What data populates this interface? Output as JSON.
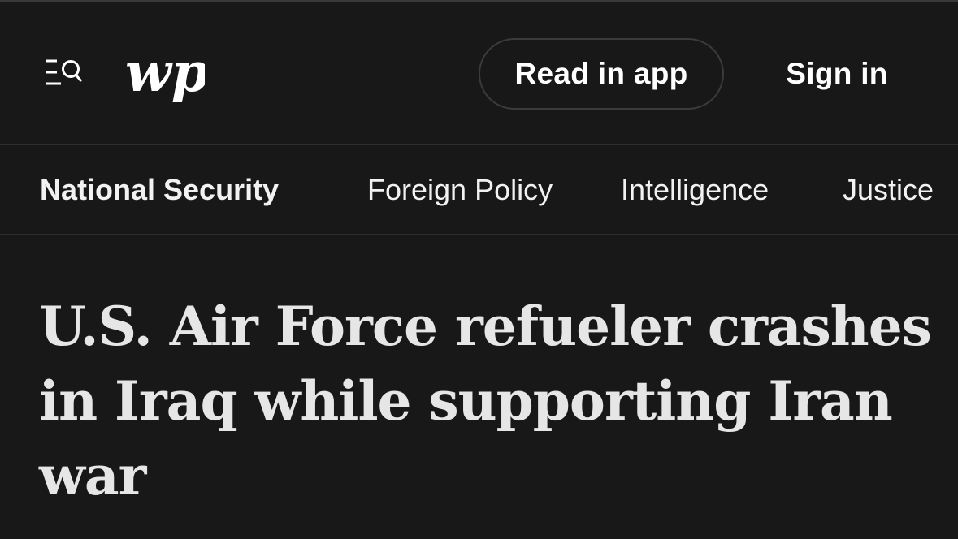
{
  "header": {
    "menu_icon": "menu-search-icon",
    "logo": "wp",
    "read_in_app_label": "Read in app",
    "sign_in_label": "Sign in"
  },
  "subnav": {
    "items": [
      {
        "label": "National Security",
        "active": true
      },
      {
        "label": "Foreign Policy",
        "active": false
      },
      {
        "label": "Intelligence",
        "active": false
      },
      {
        "label": "Justice",
        "active": false
      }
    ]
  },
  "article": {
    "headline": "U.S. Air Force refueler crashes in Iraq while supporting Iran war"
  },
  "colors": {
    "background": "#181818",
    "text": "#ffffff",
    "headline": "#e6e6e6",
    "divider": "#2e2e2e"
  }
}
